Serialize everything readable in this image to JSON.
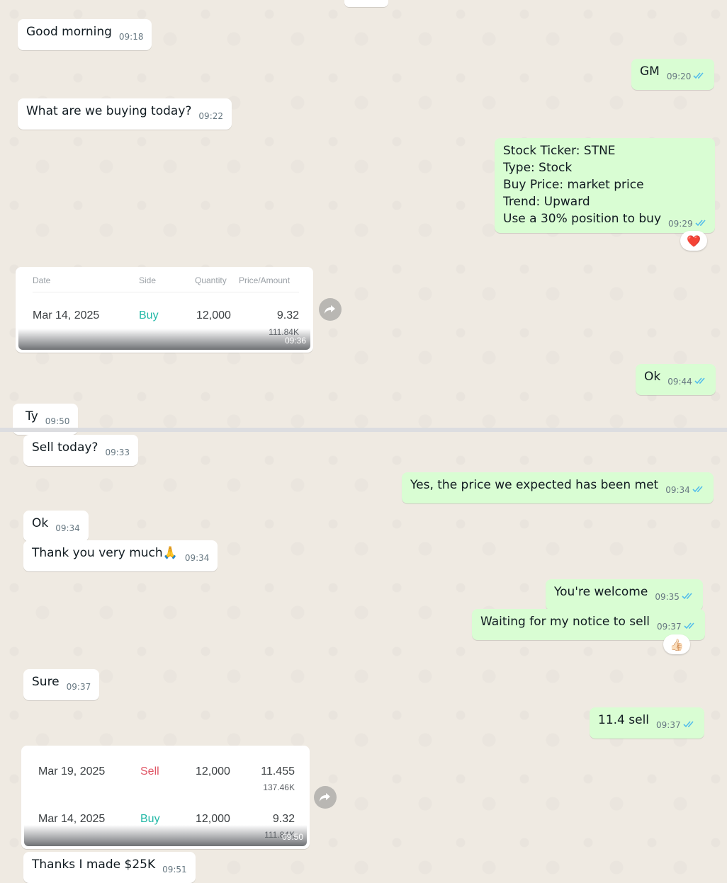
{
  "messages": [
    {
      "dir": "in",
      "text": "Good morning",
      "time": "09:18"
    },
    {
      "dir": "out",
      "text": "GM",
      "time": "09:20"
    },
    {
      "dir": "in",
      "text": "What are we buying today?",
      "time": "09:22"
    },
    {
      "dir": "out",
      "lines": [
        "Stock Ticker: STNE",
        "Type: Stock",
        "Buy Price: market price",
        "Trend: Upward",
        "Use a 30% position to buy"
      ],
      "time": "09:29",
      "reaction": "❤️"
    },
    {
      "dir": "out",
      "text": "Ok",
      "time": "09:44"
    },
    {
      "dir": "in",
      "text": "Ty",
      "time": "09:50"
    },
    {
      "dir": "in",
      "text": "Sell today?",
      "time": "09:33"
    },
    {
      "dir": "out",
      "text": "Yes, the price we expected has been met",
      "time": "09:34"
    },
    {
      "dir": "in",
      "text": "Ok",
      "time": "09:34"
    },
    {
      "dir": "in",
      "text": "Thank you very much🙏",
      "time": "09:34"
    },
    {
      "dir": "out",
      "text": "You're welcome",
      "time": "09:35"
    },
    {
      "dir": "out",
      "text": "Waiting for my notice to sell",
      "time": "09:37",
      "reaction": "👍🏻"
    },
    {
      "dir": "in",
      "text": "Sure",
      "time": "09:37"
    },
    {
      "dir": "out",
      "text": "11.4 sell",
      "time": "09:37"
    },
    {
      "dir": "in",
      "text": "Thanks I made $25K",
      "time": "09:51"
    }
  ],
  "trade_card_1": {
    "headers": [
      "Date",
      "Side",
      "Quantity",
      "Price/Amount"
    ],
    "row": {
      "date": "Mar 14, 2025",
      "side": "Buy",
      "qty": "12,000",
      "price": "9.32",
      "amount": "111.84K"
    },
    "time": "09:36"
  },
  "trade_card_2": {
    "rows": [
      {
        "date": "Mar 19, 2025",
        "side": "Sell",
        "qty": "12,000",
        "price": "11.455",
        "amount": "137.46K"
      },
      {
        "date": "Mar 14, 2025",
        "side": "Buy",
        "qty": "12,000",
        "price": "9.32",
        "amount": "111.84K"
      }
    ],
    "time": "09:50"
  },
  "colors": {
    "outgoing": "#d9fdd3",
    "incoming": "#ffffff",
    "ticks": "#53bdeb",
    "buy": "#21b8a6",
    "sell": "#e05565"
  }
}
